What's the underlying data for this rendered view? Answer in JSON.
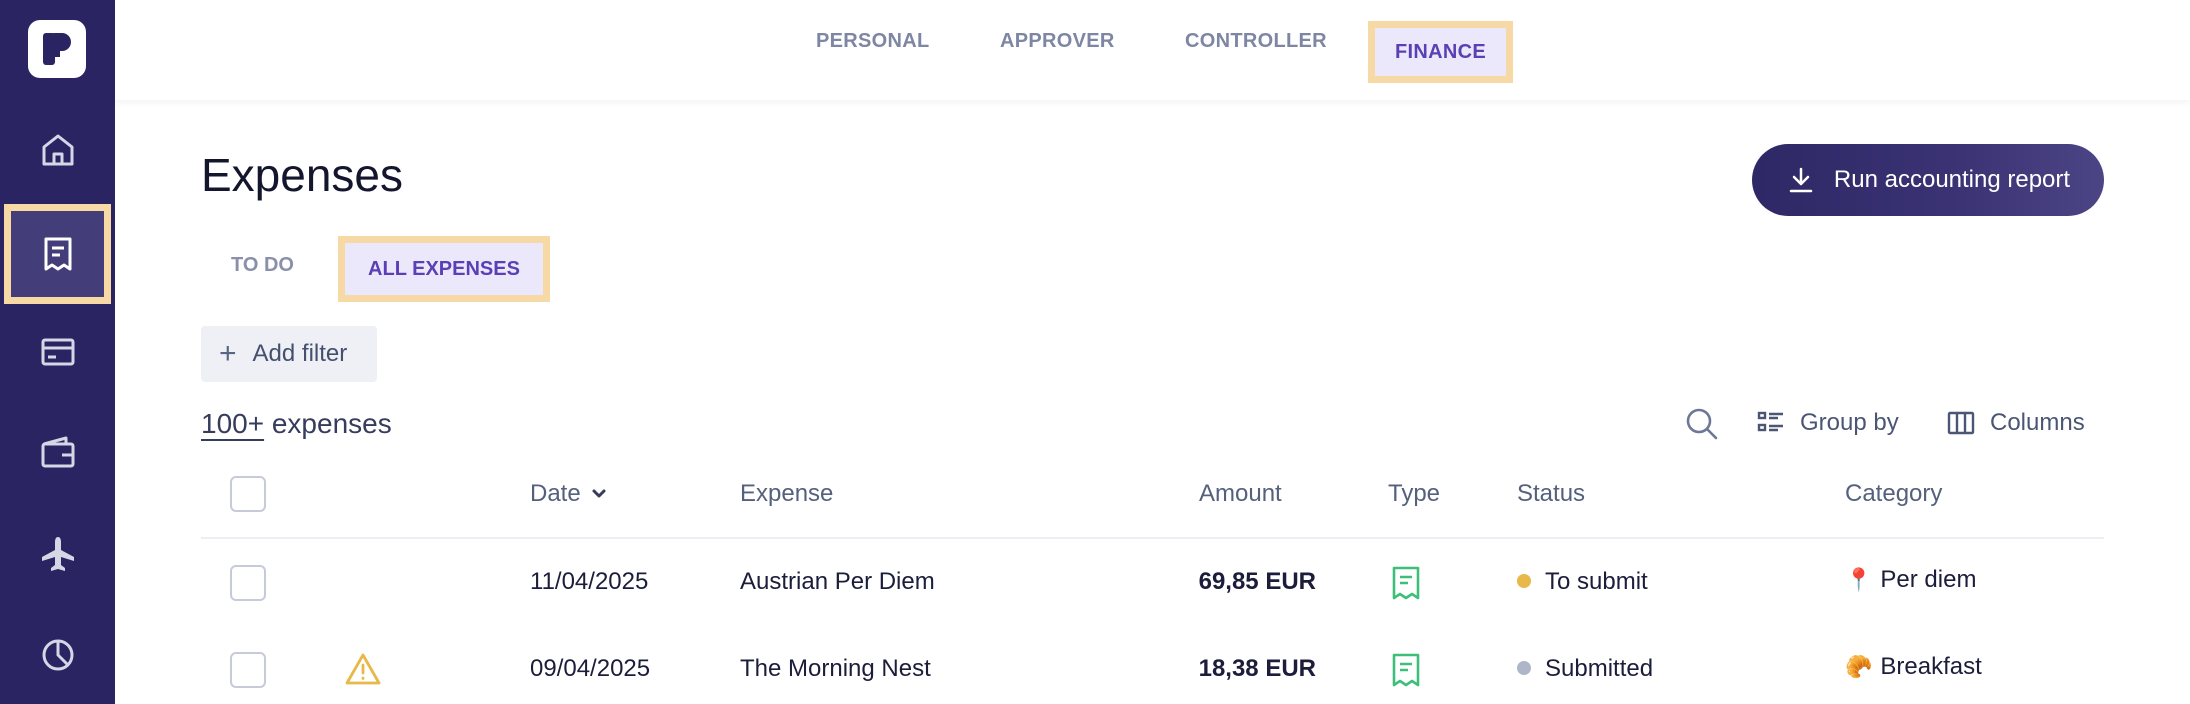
{
  "sidebar": {
    "items": [
      {
        "name": "home-icon"
      },
      {
        "name": "expenses-icon",
        "active": true
      },
      {
        "name": "card-icon"
      },
      {
        "name": "wallet-icon"
      },
      {
        "name": "travel-icon"
      },
      {
        "name": "analytics-icon"
      }
    ]
  },
  "topbar": {
    "tabs": [
      {
        "label": "PERSONAL"
      },
      {
        "label": "APPROVER"
      },
      {
        "label": "CONTROLLER"
      },
      {
        "label": "FINANCE",
        "active": true
      }
    ]
  },
  "main": {
    "title": "Expenses",
    "run_report_label": "Run accounting report",
    "subtabs": [
      {
        "label": "TO DO"
      },
      {
        "label": "ALL EXPENSES",
        "active": true
      }
    ],
    "add_filter_label": "Add filter",
    "count_number": "100+",
    "count_label": " expenses",
    "group_by_label": "Group by",
    "columns_label": "Columns"
  },
  "table": {
    "headers": {
      "date": "Date",
      "expense": "Expense",
      "amount": "Amount",
      "type": "Type",
      "status": "Status",
      "category": "Category"
    },
    "rows": [
      {
        "date": "11/04/2025",
        "expense": "Austrian Per Diem",
        "amount": "69,85 EUR",
        "status": "To submit",
        "status_color": "#e8b84a",
        "category_icon": "pin-emoji",
        "category_glyph": "📍",
        "category": "Per diem",
        "warning": false
      },
      {
        "date": "09/04/2025",
        "expense": "The Morning Nest",
        "amount": "18,38 EUR",
        "status": "Submitted",
        "status_color": "#aeb6c8",
        "category_icon": "croissant-emoji",
        "category_glyph": "🥐",
        "category": "Breakfast",
        "warning": true
      }
    ]
  },
  "colors": {
    "sidebar_bg": "#2b2462",
    "accent": "#5a3fb5",
    "highlight_border": "#f7d9a6",
    "receipt_green": "#3dbf7a",
    "warning_yellow": "#e8b84a"
  }
}
